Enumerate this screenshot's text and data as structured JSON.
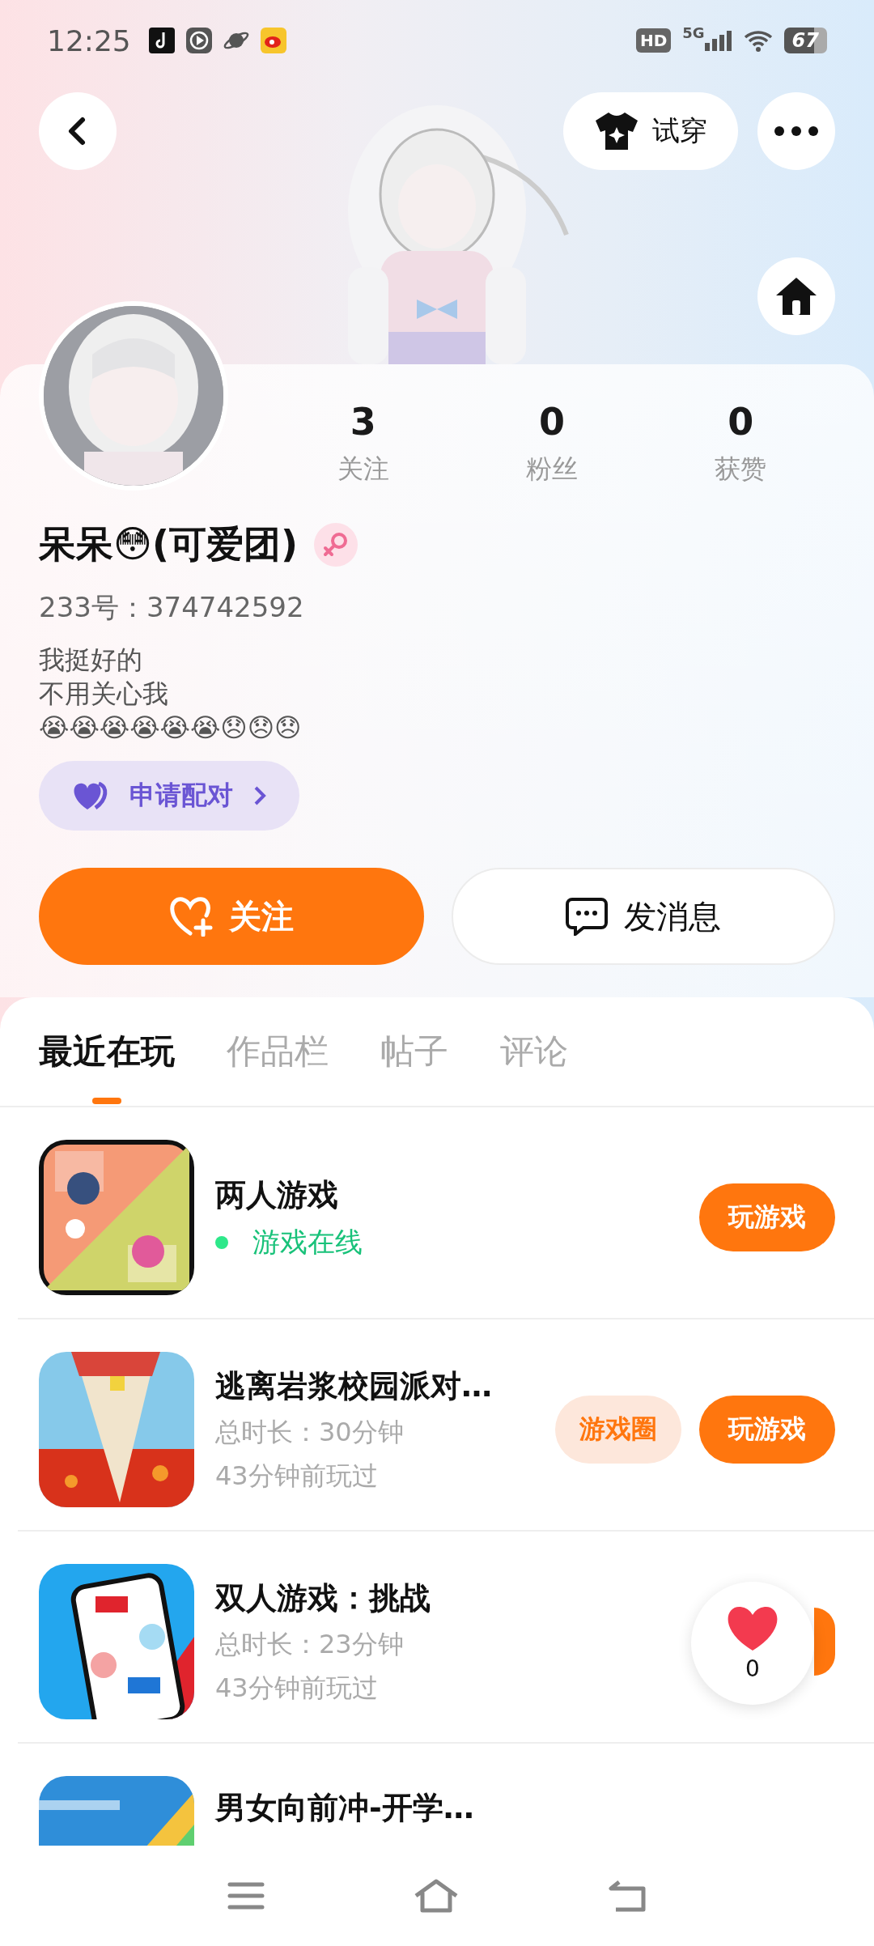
{
  "status_bar": {
    "time": "12:25",
    "hd": "HD",
    "network": "5G",
    "battery": "67"
  },
  "header": {
    "try_on": "试穿"
  },
  "profile": {
    "stats": [
      {
        "value": "3",
        "label": "关注"
      },
      {
        "value": "0",
        "label": "粉丝"
      },
      {
        "value": "0",
        "label": "获赞"
      }
    ],
    "name": "呆呆😳(可爱团)",
    "id": "233号：374742592",
    "bio": [
      "我挺好的",
      "不用关心我",
      "😭😭😭😭😭😭😞😞😞"
    ],
    "pair_button": "申请配对",
    "follow_button": "关注",
    "message_button": "发消息"
  },
  "tabs": [
    {
      "label": "最近在玩",
      "selected": true
    },
    {
      "label": "作品栏",
      "selected": false
    },
    {
      "label": "帖子",
      "selected": false
    },
    {
      "label": "评论",
      "selected": false
    }
  ],
  "games": [
    {
      "title": "两人游戏",
      "online_status": "游戏在线",
      "actions": [
        {
          "kind": "play",
          "label": "玩游戏"
        }
      ]
    },
    {
      "title": "逃离岩浆校园派对…",
      "duration": "总时长：30分钟",
      "last_played": "43分钟前玩过",
      "actions": [
        {
          "kind": "circle",
          "label": "游戏圈"
        },
        {
          "kind": "play",
          "label": "玩游戏"
        }
      ]
    },
    {
      "title": "双人游戏：挑战",
      "duration": "总时长：23分钟",
      "last_played": "43分钟前玩过",
      "actions": [
        {
          "kind": "play"
        }
      ]
    },
    {
      "title": "男女向前冲-开学…"
    }
  ],
  "floating_like": {
    "count": "0"
  }
}
